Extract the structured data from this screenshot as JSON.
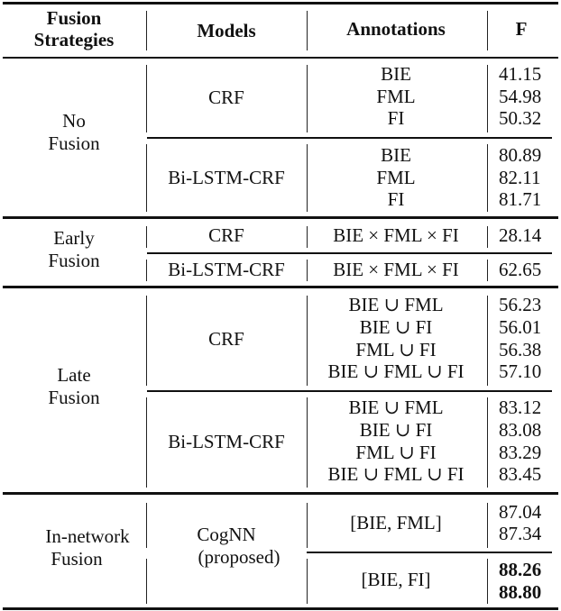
{
  "header": {
    "strategy": [
      "Fusion",
      "Strategies"
    ],
    "models": "Models",
    "annotations": "Annotations",
    "f": "F"
  },
  "groups": [
    {
      "strategy": [
        "No",
        "Fusion"
      ],
      "blocks": [
        {
          "model": [
            "CRF"
          ],
          "rows": [
            {
              "annotation": "BIE",
              "f": "41.15"
            },
            {
              "annotation": "FML",
              "f": "54.98"
            },
            {
              "annotation": "FI",
              "f": "50.32"
            }
          ]
        },
        {
          "model": [
            "Bi-LSTM-CRF"
          ],
          "rows": [
            {
              "annotation": "BIE",
              "f": "80.89"
            },
            {
              "annotation": "FML",
              "f": "82.11"
            },
            {
              "annotation": "FI",
              "f": "81.71"
            }
          ]
        }
      ]
    },
    {
      "strategy": [
        "Early",
        "Fusion"
      ],
      "blocks": [
        {
          "model": [
            "CRF"
          ],
          "rows": [
            {
              "annotation": "BIE × FML × FI",
              "f": "28.14"
            }
          ]
        },
        {
          "model": [
            "Bi-LSTM-CRF"
          ],
          "rows": [
            {
              "annotation": "BIE × FML × FI",
              "f": "62.65"
            }
          ]
        }
      ]
    },
    {
      "strategy": [
        "Late",
        "Fusion"
      ],
      "blocks": [
        {
          "model": [
            "CRF"
          ],
          "rows": [
            {
              "annotation": "BIE ∪ FML",
              "f": "56.23"
            },
            {
              "annotation": "BIE ∪ FI",
              "f": "56.01"
            },
            {
              "annotation": "FML ∪ FI",
              "f": "56.38"
            },
            {
              "annotation": "BIE ∪ FML ∪ FI",
              "f": "57.10"
            }
          ]
        },
        {
          "model": [
            "Bi-LSTM-CRF"
          ],
          "rows": [
            {
              "annotation": "BIE ∪ FML",
              "f": "83.12"
            },
            {
              "annotation": "BIE ∪ FI",
              "f": "83.08"
            },
            {
              "annotation": "FML ∪ FI",
              "f": "83.29"
            },
            {
              "annotation": "BIE ∪ FML ∪ FI",
              "f": "83.45"
            }
          ]
        }
      ]
    },
    {
      "strategy": [
        "In-network",
        "Fusion"
      ],
      "model": [
        "CogNN",
        "(proposed)"
      ],
      "blocks": [
        {
          "annotation": "[BIE, FML]",
          "f": [
            "87.04",
            "87.34"
          ],
          "bold": false
        },
        {
          "annotation": "[BIE, FI]",
          "f": [
            "88.26",
            "88.80"
          ],
          "bold": true
        }
      ]
    }
  ]
}
